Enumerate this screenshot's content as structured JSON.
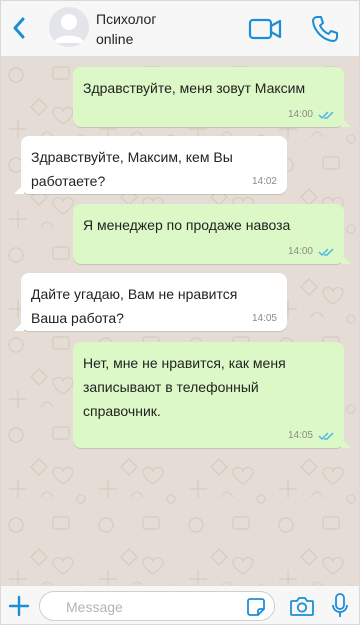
{
  "header": {
    "contact_name": "Психолог",
    "contact_status": "online"
  },
  "colors": {
    "accent": "#1a8fd6",
    "outgoing_bubble": "#dcf8c6",
    "incoming_bubble": "#ffffff",
    "chat_background": "#e5ddd5",
    "read_ticks": "#4fb5e6"
  },
  "messages": [
    {
      "direction": "outgoing",
      "text": "Здравствуйте, меня зовут Максим",
      "time": "14:00",
      "read": true
    },
    {
      "direction": "incoming",
      "text": "Здравствуйте, Максим, кем Вы работаете?",
      "time": "14:02"
    },
    {
      "direction": "outgoing",
      "text": "Я менеджер по продаже навоза",
      "time": "14:00",
      "read": true
    },
    {
      "direction": "incoming",
      "text": "Дайте угадаю, Вам не нравится Ваша работа?",
      "time": "14:05"
    },
    {
      "direction": "outgoing",
      "text": "Нет, мне не нравится, как меня записывают в телефонный справочник.",
      "time": "14:05",
      "read": true
    }
  ],
  "composer": {
    "placeholder": "Message",
    "value": ""
  },
  "icons": {
    "back": "chevron-left-icon",
    "video": "video-camera-icon",
    "phone": "phone-icon",
    "attach": "plus-icon",
    "sticker": "sticker-icon",
    "camera": "camera-icon",
    "mic": "microphone-icon",
    "read_receipt": "double-check-icon"
  }
}
